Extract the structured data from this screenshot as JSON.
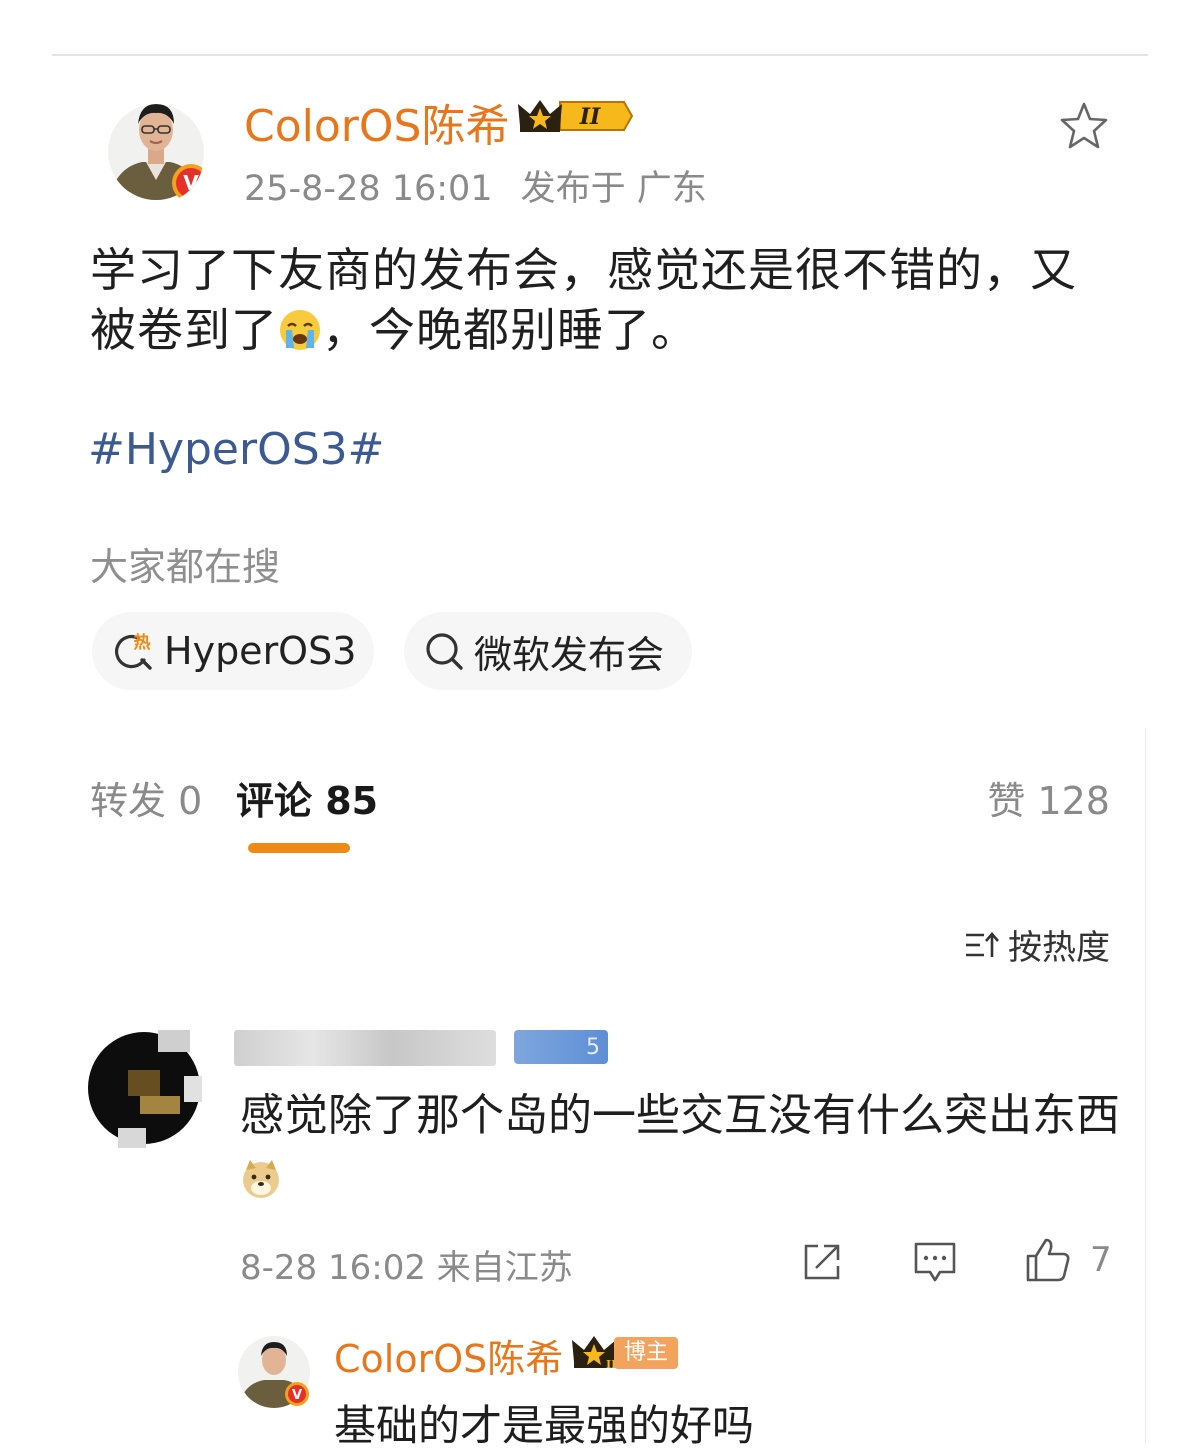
{
  "post": {
    "author": "ColorOS陈希",
    "level_badge": "II",
    "verified_mark": "V",
    "time": "25-8-28 16:01",
    "location": "发布于 广东",
    "text_part1": "学习了下友商的发布会，感觉还是很不错的，又被卷到了",
    "text_part2": "，今晚都别睡了。",
    "emoji": "crying-face-emoji",
    "hashtag": "#HyperOS3#"
  },
  "search": {
    "title": "大家都在搜",
    "hot_icon_char": "热",
    "chips": [
      "HyperOS3",
      "微软发布会"
    ]
  },
  "tabs": {
    "repost": "转发 0",
    "comments": "评论 85",
    "likes": "赞 128",
    "active_color": "#f08a16"
  },
  "sort": {
    "label": "按热度"
  },
  "comment": {
    "badge_partial": "5",
    "text_part1": "感觉除了那个岛的一些交互没有什么突出东西",
    "emoji": "doge-emoji",
    "time": "8-28 16:02 来自江苏",
    "like_count": "7"
  },
  "reply": {
    "author": "ColorOS陈希",
    "level_badge": "II",
    "tag": "博主",
    "text": "基础的才是最强的好吗"
  },
  "colors": {
    "author_orange": "#e8761a",
    "hashtag_blue": "#3b5a91",
    "verify_red": "#e6312a"
  }
}
